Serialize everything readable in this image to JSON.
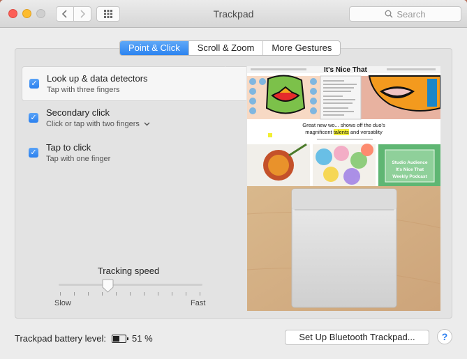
{
  "window": {
    "title": "Trackpad"
  },
  "toolbar": {
    "search_placeholder": "Search"
  },
  "tabs": [
    {
      "label": "Point & Click",
      "active": true
    },
    {
      "label": "Scroll & Zoom",
      "active": false
    },
    {
      "label": "More Gestures",
      "active": false
    }
  ],
  "options": [
    {
      "title": "Look up & data detectors",
      "subtitle": "Tap with three fingers",
      "checked": true
    },
    {
      "title": "Secondary click",
      "subtitle": "Click or tap with two fingers",
      "checked": true
    },
    {
      "title": "Tap to click",
      "subtitle": "Tap with one finger",
      "checked": true
    }
  ],
  "preview": {
    "site_title": "It's Nice That",
    "headline_1": "Great new wo... shows off the duo's",
    "headline_2_pre": "magnificent ",
    "headline_2_hl": "talents",
    "headline_2_post": " and versatility",
    "tile_text": [
      "Studio Audience",
      "It's Nice That",
      "Weekly Podcast"
    ]
  },
  "tracking": {
    "label": "Tracking speed",
    "min_label": "Slow",
    "max_label": "Fast",
    "value": 0.34
  },
  "battery": {
    "label": "Trackpad battery level:",
    "value": "51 %",
    "level": 0.51
  },
  "buttons": {
    "setup": "Set Up Bluetooth Trackpad...",
    "help": "?"
  },
  "colors": {
    "accent": "#2c84f0"
  }
}
